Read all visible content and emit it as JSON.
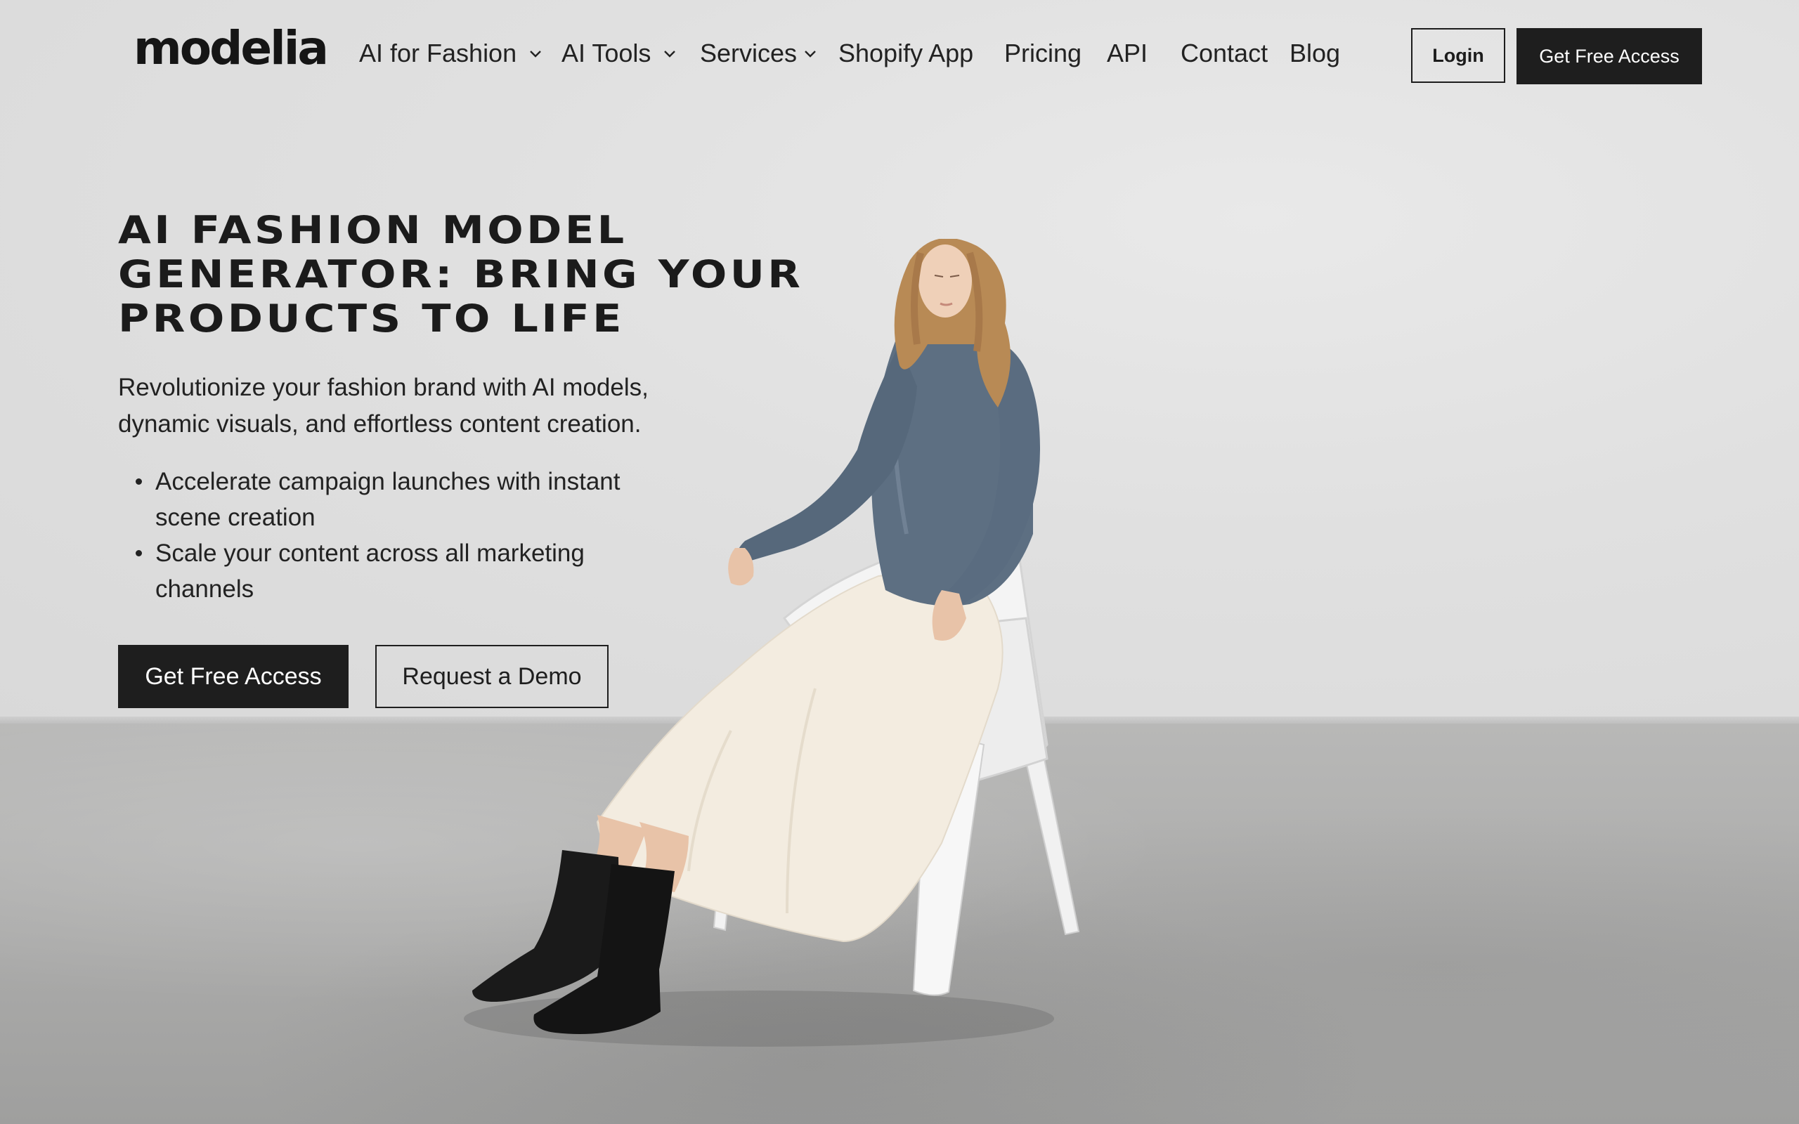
{
  "header": {
    "logo_text": "modelia",
    "nav": [
      {
        "label": "AI for Fashion",
        "has_dropdown": true
      },
      {
        "label": "AI Tools",
        "has_dropdown": true
      },
      {
        "label": "Services",
        "has_dropdown": true
      },
      {
        "label": "Shopify App",
        "has_dropdown": false
      },
      {
        "label": "Pricing",
        "has_dropdown": false
      },
      {
        "label": "API",
        "has_dropdown": false
      },
      {
        "label": "Contact",
        "has_dropdown": false
      },
      {
        "label": "Blog",
        "has_dropdown": false
      }
    ],
    "login_label": "Login",
    "cta_label": "Get Free Access"
  },
  "hero": {
    "title": "AI Fashion Model Generator: Bring Your Products to Life",
    "subtitle": "Revolutionize your fashion brand with AI models, dynamic visuals, and effortless content creation.",
    "bullets": [
      "Accelerate campaign launches with instant scene creation",
      "Scale your content across all marketing channels"
    ],
    "primary_cta": "Get Free Access",
    "secondary_cta": "Request a Demo"
  },
  "icons": {
    "dropdown": "chevron-down-icon",
    "bullet": "bullet-dot-icon"
  },
  "colors": {
    "text": "#1c1c1c",
    "button_dark": "#1e1e1e",
    "button_text_light": "#ffffff",
    "wall": "#e0e0e0",
    "floor": "#a9a9a8"
  }
}
